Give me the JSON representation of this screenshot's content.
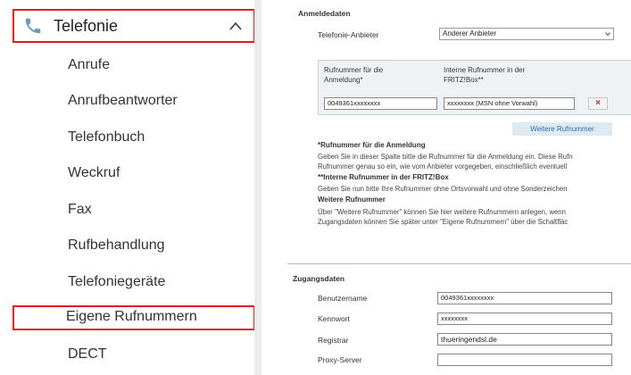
{
  "nav": {
    "header": {
      "title": "Telefonie"
    },
    "items": [
      "Anrufe",
      "Anrufbeantworter",
      "Telefonbuch",
      "Weckruf",
      "Fax",
      "Rufbehandlung",
      "Telefoniegeräte",
      "Eigene Rufnummern",
      "DECT"
    ],
    "selected": "Eigene Rufnummern",
    "colors": {
      "highlight": "#e02020"
    },
    "icons": {
      "header": "phone-icon",
      "toggle": "chevron-up-icon"
    }
  },
  "anmeldedaten": {
    "title": "Anmeldedaten",
    "provider_label": "Telefonie-Anbieter",
    "provider_value": "Anderer Anbieter",
    "table": {
      "col1_header": [
        "Rufnummer für die",
        "Anmeldung*"
      ],
      "col2_header": [
        "Interne Rufnummer in der",
        "FRITZ!Box**"
      ],
      "row": {
        "number": "0049361xxxxxxxx",
        "internal": "xxxxxxxx (MSN ohne Vorwahl)",
        "delete_label": "×"
      }
    },
    "more_button": "Weitere Rufnummer",
    "help": {
      "h1": "*Rufnummer für die Anmeldung",
      "t1a": "Geben Sie in dieser Spalte bitte die Rufnummer für die Anmeldung ein. Diese Rufn",
      "t1b": "Rufnummer genau so ein, wie vom Anbieter vorgegeben, einschließlich eventuell",
      "h2": "**Interne Rufnummer in der FRITZ!Box",
      "t2": "Geben Sie nun bitte Ihre Rufnummer ohne Ortsvorwahl und ohne Sonderzeichen",
      "h3": "Weitere Rufnummer",
      "t3a": "Über \"Weitere Rufnummer\" können Sie hier weitere Rufnummern anlegen, wenn",
      "t3b": "Zugangsdaten können Sie später unter \"Eigene Rufnummern\" über die Schaltfläc"
    }
  },
  "zugangsdaten": {
    "title": "Zugangsdaten",
    "fields": {
      "username_label": "Benutzername",
      "username_value": "0049361xxxxxxxx",
      "password_label": "Kennwort",
      "password_value": "xxxxxxxx",
      "registrar_label": "Registrar",
      "registrar_value": "thueringendsl.de",
      "proxy_label": "Proxy-Server",
      "proxy_value": ""
    }
  }
}
